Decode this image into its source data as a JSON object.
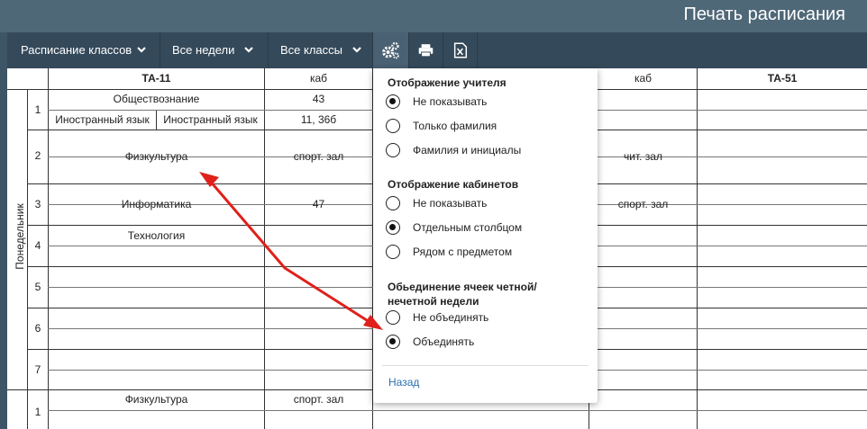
{
  "header": {
    "title": "Печать расписания"
  },
  "toolbar": {
    "class_schedule": "Расписание классов",
    "all_weeks": "Все недели",
    "all_classes": "Все классы",
    "settings_icon": "gears-icon",
    "print_icon": "printer-icon",
    "excel_icon": "excel-icon"
  },
  "table": {
    "headers": {
      "class_1": "ТА-11",
      "room_1": "каб",
      "room_2": "каб",
      "class_3": "ТА-51"
    },
    "day": "Понедельник",
    "lessons": [
      "1",
      "2",
      "3",
      "4",
      "5",
      "6",
      "7",
      "1"
    ],
    "cells": {
      "l1_subject": "Обществознание",
      "l1_room": "43",
      "l1_sub_a": "Иностранный язык",
      "l1_sub_b": "Иностранный язык",
      "l1_sub_room": "11, 36б",
      "l2_subject": "Физкультура",
      "l2_room": "спорт. зал",
      "l2_room_2": "чит. зал",
      "l3_subject": "Информатика",
      "l3_room": "47",
      "l3_room_2": "спорт. зал",
      "l4_subject": "Технология",
      "next_subject": "Физкультура",
      "next_room": "спорт. зал"
    }
  },
  "settings_popup": {
    "teacher_section": {
      "title": "Отображение учителя",
      "options": [
        "Не показывать",
        "Только фамилия",
        "Фамилия и инициалы"
      ],
      "selected": 0
    },
    "room_section": {
      "title": "Отображение кабинетов",
      "options": [
        "Не показывать",
        "Отдельным столбцом",
        "Рядом с предметом"
      ],
      "selected": 1
    },
    "merge_section": {
      "title": "Обьединение ячеек четной/ нечетной недели",
      "options": [
        "Не объединять",
        "Объединять"
      ],
      "selected": 1
    },
    "back": "Назад"
  },
  "colors": {
    "title_bar": "#4f6878",
    "toolbar": "#34495a",
    "active_tool": "#4a6173",
    "arrow": "#e0201b",
    "link": "#2a6fb0"
  }
}
